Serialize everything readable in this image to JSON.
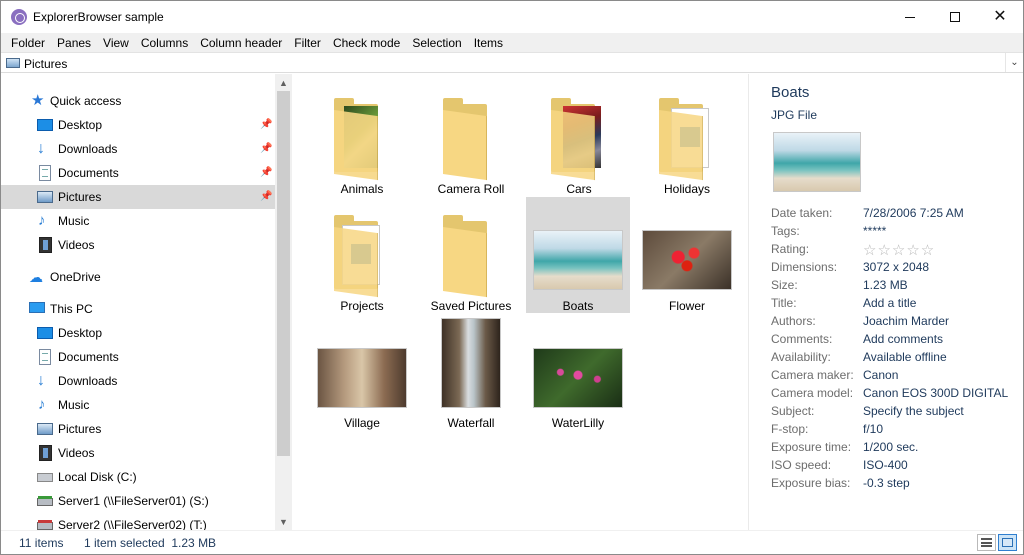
{
  "window": {
    "title": "ExplorerBrowser sample"
  },
  "menu": [
    "Folder",
    "Panes",
    "View",
    "Columns",
    "Column header",
    "Filter",
    "Check mode",
    "Selection",
    "Items"
  ],
  "address": {
    "text": "Pictures"
  },
  "nav": {
    "quick_access": "Quick access",
    "qa_items": [
      "Desktop",
      "Downloads",
      "Documents",
      "Pictures",
      "Music",
      "Videos"
    ],
    "onedrive": "OneDrive",
    "this_pc": "This PC",
    "pc_items": [
      "Desktop",
      "Documents",
      "Downloads",
      "Music",
      "Pictures",
      "Videos",
      "Local Disk (C:)",
      "Server1 (\\\\FileServer01) (S:)",
      "Server2 (\\\\FileServer02) (T:)"
    ]
  },
  "items": [
    "Animals",
    "Camera Roll",
    "Cars",
    "Holidays",
    "Projects",
    "Saved Pictures",
    "Boats",
    "Flower",
    "Village",
    "Waterfall",
    "WaterLilly"
  ],
  "preview": {
    "title": "Boats",
    "type": "JPG File",
    "properties": [
      {
        "key": "Date taken:",
        "value": "7/28/2006 7:25 AM"
      },
      {
        "key": "Tags:",
        "value": "*****"
      },
      {
        "key": "Rating:",
        "value": "☆☆☆☆☆"
      },
      {
        "key": "Dimensions:",
        "value": "3072 x 2048"
      },
      {
        "key": "Size:",
        "value": "1.23 MB"
      },
      {
        "key": "Title:",
        "value": "Add a title"
      },
      {
        "key": "Authors:",
        "value": "Joachim Marder"
      },
      {
        "key": "Comments:",
        "value": "Add comments"
      },
      {
        "key": "Availability:",
        "value": "Available offline"
      },
      {
        "key": "Camera maker:",
        "value": "Canon"
      },
      {
        "key": "Camera model:",
        "value": "Canon EOS 300D DIGITAL"
      },
      {
        "key": "Subject:",
        "value": "Specify the subject"
      },
      {
        "key": "F-stop:",
        "value": "f/10"
      },
      {
        "key": "Exposure time:",
        "value": "1/200 sec."
      },
      {
        "key": "ISO speed:",
        "value": "ISO-400"
      },
      {
        "key": "Exposure bias:",
        "value": "-0.3 step"
      }
    ]
  },
  "status": {
    "count": "11 items",
    "selection": "1 item selected  1.23 MB"
  }
}
